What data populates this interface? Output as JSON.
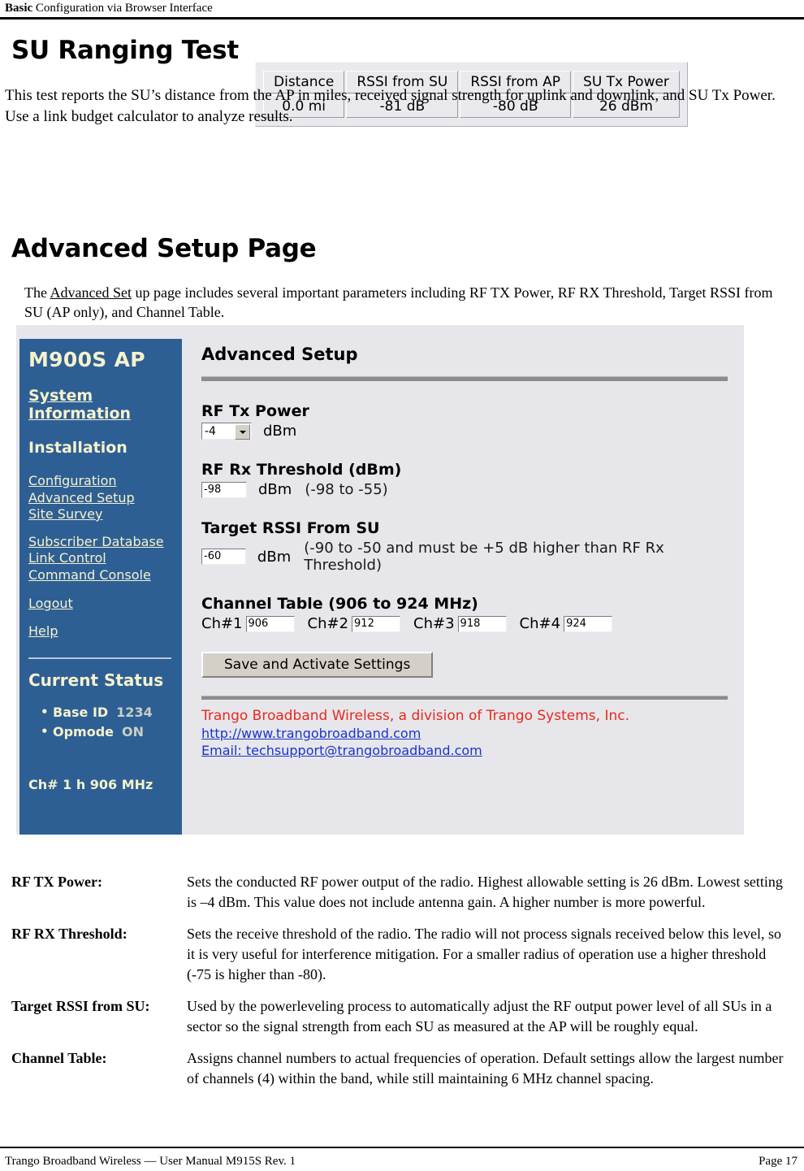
{
  "running_head": {
    "bold": "Basic",
    "rest": " Configuration via Browser Interface"
  },
  "su_section": {
    "heading": "SU Ranging Test",
    "paragraph": "This test reports the SU’s distance from the AP in miles, received signal strength for uplink and downlink, and SU Tx Power.  Use a link budget calculator to analyze results.",
    "table": {
      "headers": [
        "Distance",
        "RSSI from SU",
        "RSSI from AP",
        "SU Tx Power"
      ],
      "values": [
        "0.0 mi",
        "-81 dB",
        "-80 dB",
        "26 dBm"
      ]
    }
  },
  "adv_section": {
    "heading": "Advanced Setup Page",
    "paragraph_pre": "The ",
    "paragraph_underlined": "Advanced Set",
    "paragraph_post": " up page includes several important parameters including RF TX Power, RF RX Threshold, Target RSSI from SU (AP only), and Channel Table."
  },
  "screenshot": {
    "sidebar": {
      "title": "M900S AP",
      "system_information": "System Information",
      "installation": "Installation",
      "links_group1": [
        "Configuration",
        "Advanced Setup",
        "Site Survey"
      ],
      "links_group2": [
        "Subscriber Database",
        "Link Control",
        "Command Console"
      ],
      "logout": "Logout",
      "help": "Help",
      "status_title": "Current Status",
      "status_items": [
        {
          "label": "Base ID",
          "value": "1234"
        },
        {
          "label": "Opmode",
          "value": "ON"
        }
      ],
      "channel_status": "Ch# 1 h 906 MHz",
      "bg_color": "#2d5f94",
      "text_color": "#f6f2cd"
    },
    "main": {
      "title": "Advanced Setup",
      "rf_tx_power": {
        "label": "RF Tx Power",
        "value": "-4",
        "unit": "dBm"
      },
      "rf_rx_threshold": {
        "label": "RF Rx Threshold (dBm)",
        "value": "-98",
        "unit": "dBm",
        "hint": "(-98 to -55)"
      },
      "target_rssi": {
        "label": "Target RSSI From SU",
        "value": "-60",
        "unit": "dBm",
        "hint": "(-90 to -50 and must be +5 dB higher than RF Rx Threshold)"
      },
      "channel_table": {
        "label": "Channel Table (906 to 924 MHz)",
        "channels": [
          {
            "label": "Ch#1",
            "value": "906"
          },
          {
            "label": "Ch#2",
            "value": "912"
          },
          {
            "label": "Ch#3",
            "value": "918"
          },
          {
            "label": "Ch#4",
            "value": "924"
          }
        ]
      },
      "save_button": "Save and Activate Settings",
      "footer": {
        "company": "Trango Broadband Wireless, a division of Trango Systems, Inc.",
        "website": "http://www.trangobroadband.com",
        "email": "Email: techsupport@trangobroadband.com",
        "company_color": "#e8291e",
        "link_color": "#1b35c9"
      }
    }
  },
  "definitions": [
    {
      "term": "RF TX Power:",
      "desc": "Sets the conducted RF power output of the radio.  Highest allowable setting is 26 dBm.  Lowest setting is –4 dBm.  This value does not include antenna gain.  A higher number is more powerful."
    },
    {
      "term": "RF RX Threshold:",
      "desc": "Sets the receive threshold of the radio.  The radio will not process signals received below this level, so it is very useful for interference mitigation.  For a smaller radius of operation use a higher threshold (-75 is higher than -80)."
    },
    {
      "term": "Target RSSI from SU:",
      "desc": "Used by the powerleveling process to automatically adjust the RF output power level of all SUs in a sector so the signal strength from each SU as measured at the AP will be roughly equal."
    },
    {
      "term": "Channel Table:",
      "desc": "Assigns channel numbers to actual frequencies of operation.  Default settings allow the largest number of channels (4) within the band, while still maintaining 6 MHz channel spacing."
    }
  ],
  "footer": {
    "left": "Trango Broadband Wireless — User Manual M915S Rev. 1",
    "right": "Page 17"
  }
}
